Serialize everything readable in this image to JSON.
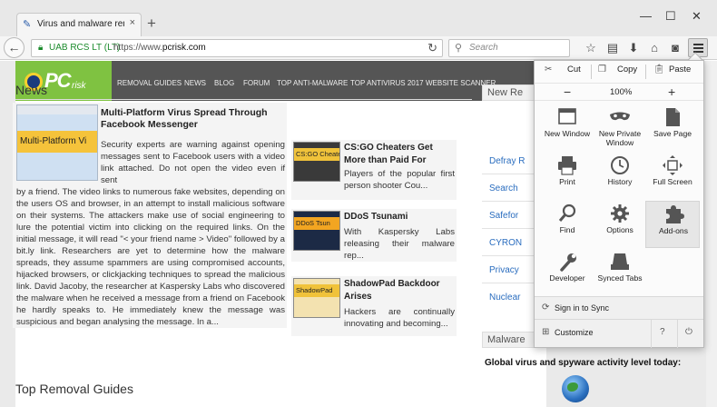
{
  "browser": {
    "tab_title": "Virus and malware removal",
    "tab_close": "×",
    "new_tab": "+",
    "win_min": "—",
    "win_max": "☐",
    "win_close": "✕",
    "back": "←",
    "identity": "UAB RCS LT (LT)",
    "url_prefix": "https://www.",
    "url_domain": "pcrisk.com",
    "reload": "↻",
    "search_placeholder": "Search",
    "icons": [
      "star-icon",
      "reading-list-icon",
      "download-icon",
      "home-icon",
      "pocket-icon",
      "menu-icon"
    ]
  },
  "site": {
    "logo_pc": "PC",
    "logo_risk": "risk",
    "menu": [
      "REMOVAL GUIDES",
      "NEWS",
      "BLOG",
      "FORUM",
      "TOP ANTI-MALWARE",
      "TOP ANTIVIRUS 2017",
      "WEBSITE SCANNER"
    ],
    "news_heading": "News",
    "lead": {
      "thumb_text": "Multi-Platform Vi",
      "title": "Multi-Platform Virus Spread Through Facebook Messenger",
      "body_indent": "Security experts are warning against opening messages sent to Facebook users with a video link attached. Do not open the video even if sent",
      "body_rest": "by a friend. The video links to numerous fake websites, depending on the users OS and browser, in an attempt to install malicious software on their systems. The attackers make use of social engineering to lure the potential victim into clicking on the required links. On the initial message, it will read \"< your friend name > Video\" followed by a bit.ly link. Researchers are yet to determine how the malware spreads, they assume spammers are using compromised accounts, hijacked browsers, or clickjacking techniques to spread the malicious link. David Jacoby, the researcher at Kaspersky Labs who discovered the malware when he received a message from a friend on Facebook he hardly speaks to. He immediately knew the message was suspicious and began analysing the message. In a..."
    },
    "side": [
      {
        "thumb": "CS:GO Cheaters",
        "title": "CS:GO Cheaters Get More than Paid For",
        "body": "Players of the popular first person shooter Cou..."
      },
      {
        "thumb": "DDoS Tsun",
        "title": "DDoS Tsunami",
        "body": "With Kaspersky Labs releasing their malware rep..."
      },
      {
        "thumb": "ShadowPad",
        "title": "ShadowPad Backdoor Arises",
        "body": "Hackers are continually innovating and becoming..."
      }
    ],
    "right_heading": "New Re",
    "right_links": [
      "Defray R",
      "Search",
      "Safefor",
      "CYRON",
      "Privacy",
      "Nuclear"
    ],
    "malware_heading": "Malware",
    "malware_text": "Global virus and spyware activity level today:",
    "top_removal": "Top Removal Guides"
  },
  "panel": {
    "cut": "Cut",
    "copy": "Copy",
    "paste": "Paste",
    "zoom_minus": "−",
    "zoom": "100%",
    "zoom_plus": "+",
    "items": [
      {
        "label": "New Window",
        "icon": "new-window-icon"
      },
      {
        "label": "New Private Window",
        "icon": "private-mask-icon"
      },
      {
        "label": "Save Page",
        "icon": "save-page-icon"
      },
      {
        "label": "Print",
        "icon": "print-icon"
      },
      {
        "label": "History",
        "icon": "history-clock-icon"
      },
      {
        "label": "Full Screen",
        "icon": "fullscreen-icon"
      },
      {
        "label": "Find",
        "icon": "find-magnifier-icon"
      },
      {
        "label": "Options",
        "icon": "options-gear-icon"
      },
      {
        "label": "Add-ons",
        "icon": "addons-puzzle-icon"
      },
      {
        "label": "Developer",
        "icon": "developer-wrench-icon"
      },
      {
        "label": "Synced Tabs",
        "icon": "synced-tabs-icon"
      }
    ],
    "sign_in": "Sign in to Sync",
    "customize": "Customize"
  }
}
